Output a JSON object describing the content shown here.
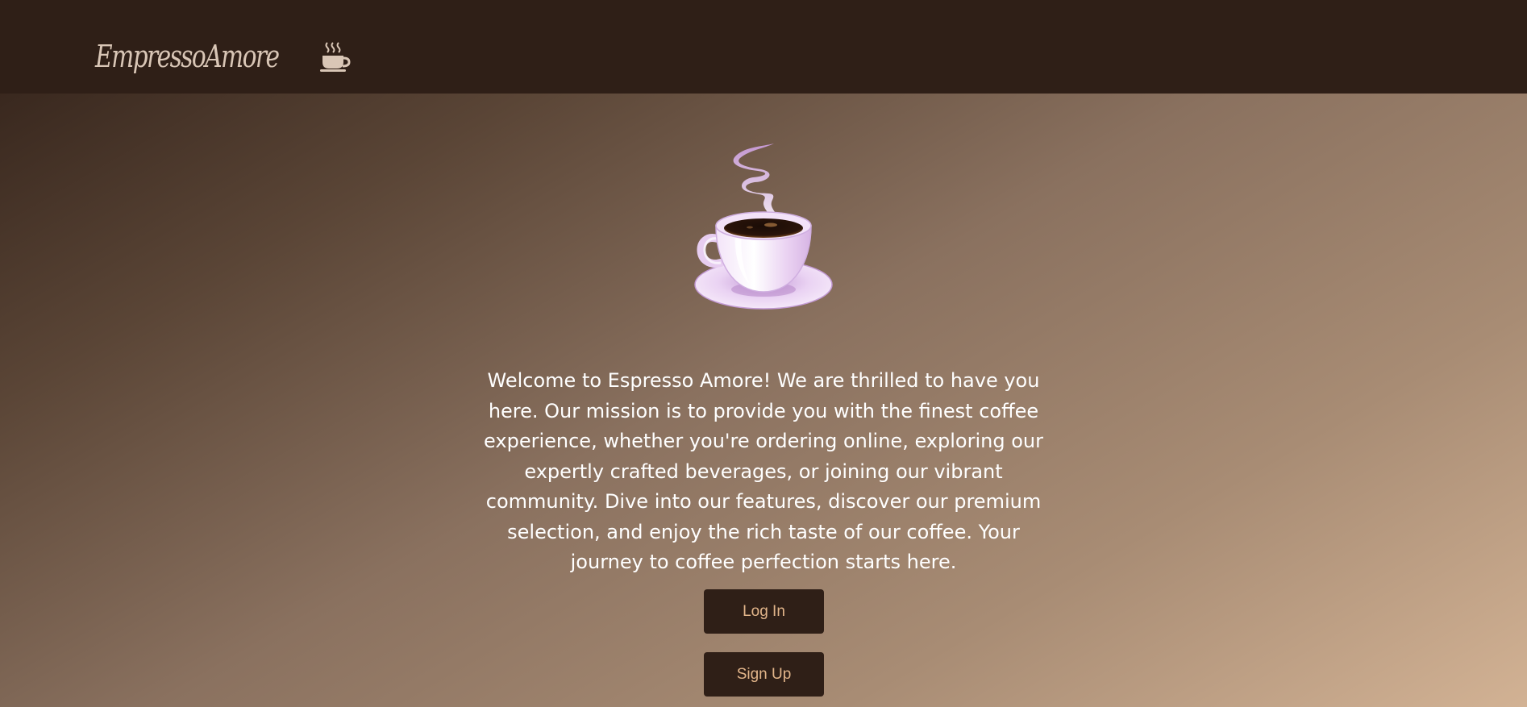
{
  "header": {
    "brand_name": "EmpressoAmore",
    "brand_icon": "coffee-cup-icon"
  },
  "hero": {
    "illustration": "steaming-coffee-cup",
    "welcome_text": "Welcome to Espresso Amore! We are thrilled to have you here. Our mission is to provide you with the finest coffee experience, whether you're ordering online, exploring our expertly crafted beverages, or joining our vibrant community. Dive into our features, discover our premium selection, and enjoy the rich taste of our coffee. Your journey to coffee perfection starts here."
  },
  "actions": {
    "login_label": "Log In",
    "signup_label": "Sign Up"
  },
  "colors": {
    "header_bg": "#2f1f17",
    "button_bg": "#2f1f17",
    "button_text": "#e2b58a",
    "brand_text": "#d9c6b6",
    "gradient_start": "#2f1f17",
    "gradient_end": "#d2b294"
  }
}
